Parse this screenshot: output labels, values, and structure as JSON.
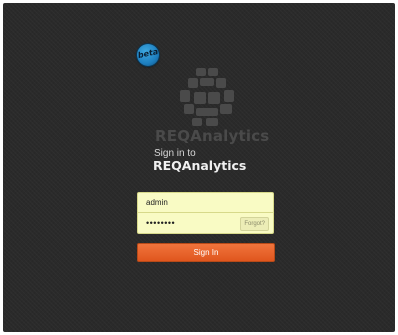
{
  "badge": {
    "label": "beta",
    "icon": "beta-badge-icon",
    "color": "#1d7fc0"
  },
  "brand": {
    "logo_icon": "reqanalytics-logo-icon",
    "name": "REQAnalytics"
  },
  "signin": {
    "caption": "Sign in to",
    "app_name": "REQAnalytics"
  },
  "form": {
    "username_value": "admin",
    "password_value": "••••••••",
    "forgot_label": "Forgot?",
    "field_color": "#f9fbc4"
  },
  "submit": {
    "label": "Sign In",
    "color": "#e8602a"
  }
}
